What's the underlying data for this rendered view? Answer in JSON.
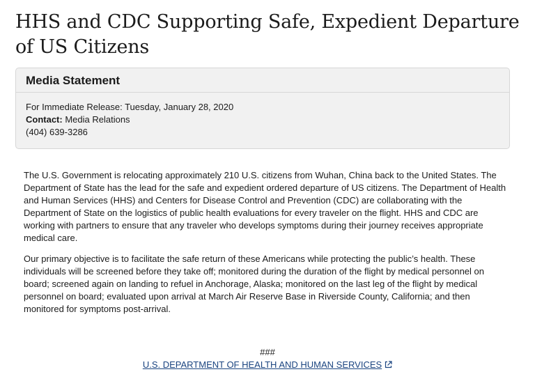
{
  "title": "HHS and CDC Supporting Safe, Expedient Departure of US Citizens",
  "statement": {
    "heading": "Media Statement",
    "release_line": "For Immediate Release: Tuesday, January 28, 2020",
    "contact_label": "Contact:",
    "contact_value": "Media Relations",
    "phone": "(404) 639-3286"
  },
  "body": {
    "paragraph_1": "The U.S. Government is relocating approximately 210 U.S. citizens from Wuhan, China back to the United States.  The Department of State has the lead for the safe and expedient ordered departure of US citizens. The Department of Health and Human Services (HHS) and Centers for Disease Control and Prevention (CDC) are collaborating with the Department of State on the logistics of public health evaluations for every traveler on the flight. HHS and CDC are working with partners to ensure that any traveler who develops symptoms during their journey receives appropriate medical care.",
    "paragraph_2": "Our primary objective is to facilitate the safe return of these Americans while protecting the public’s health. These individuals will be screened before they take off; monitored during the duration of the flight by medical personnel on board; screened again on landing to refuel in Anchorage, Alaska; monitored on the last leg of the flight by medical personnel on board; evaluated upon arrival at March Air Reserve Base in Riverside County, California; and then monitored for symptoms post-arrival."
  },
  "footer": {
    "end_mark": "###",
    "link_text": "U.S. DEPARTMENT OF HEALTH AND HUMAN SERVICES",
    "link_icon": "external-link-icon",
    "link_color": "#1a4480"
  }
}
